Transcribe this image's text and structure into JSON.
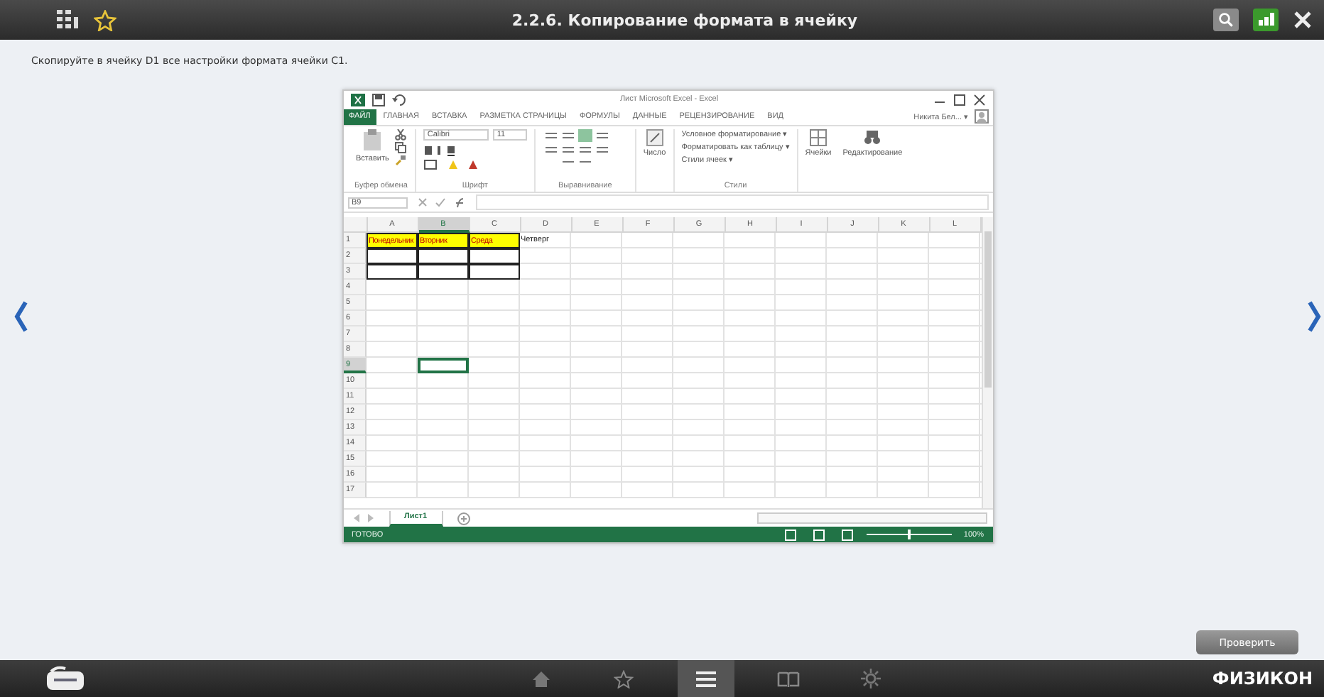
{
  "top_bar": {
    "title": "2.2.6. Копирование формата в ячейку"
  },
  "instruction": "Скопируйте в ячейку D1 все настройки формата ячейки C1.",
  "excel": {
    "title": "Лист Microsoft Excel - Excel",
    "tabs": [
      {
        "label": "ФАЙЛ",
        "selected": true
      },
      {
        "label": "ГЛАВНАЯ",
        "selected": false
      },
      {
        "label": "ВСТАВКА",
        "selected": false
      },
      {
        "label": "РАЗМЕТКА СТРАНИЦЫ",
        "selected": false
      },
      {
        "label": "ФОРМУЛЫ",
        "selected": false
      },
      {
        "label": "ДАННЫЕ",
        "selected": false
      },
      {
        "label": "РЕЦЕНЗИРОВАНИЕ",
        "selected": false
      },
      {
        "label": "ВИД",
        "selected": false
      }
    ],
    "user": "Никита Бел... ▾",
    "ribbon": {
      "paste": "Вставить",
      "font_name": "Calibri",
      "font_size": "11",
      "number": "Число",
      "styles": [
        "Условное форматирование ▾",
        "Форматировать как таблицу ▾",
        "Стили ячеек ▾"
      ],
      "cells": "Ячейки",
      "editing": "Редактирование",
      "groups": [
        "Буфер обмена",
        "Шрифт",
        "Выравнивание",
        "Стили"
      ]
    },
    "name_box": "B9",
    "columns": [
      {
        "label": "A",
        "selected": false
      },
      {
        "label": "B",
        "selected": true
      },
      {
        "label": "C",
        "selected": false
      },
      {
        "label": "D",
        "selected": false
      },
      {
        "label": "E",
        "selected": false
      },
      {
        "label": "F",
        "selected": false
      },
      {
        "label": "G",
        "selected": false
      },
      {
        "label": "H",
        "selected": false
      },
      {
        "label": "I",
        "selected": false
      },
      {
        "label": "J",
        "selected": false
      },
      {
        "label": "K",
        "selected": false
      },
      {
        "label": "L",
        "selected": false
      }
    ],
    "rows": [
      {
        "label": "1",
        "selected": false,
        "cells": [
          {
            "text": "Понедельник",
            "formatted": true,
            "bordered": true
          },
          {
            "text": "Вторник",
            "formatted": true,
            "bordered": true
          },
          {
            "text": "Среда",
            "formatted": true,
            "bordered": true
          },
          {
            "text": "Четверг",
            "formatted": false,
            "bordered": false
          }
        ]
      },
      {
        "label": "2",
        "selected": false,
        "cells": [
          {
            "bordered": true
          },
          {
            "bordered": true
          },
          {
            "bordered": true
          }
        ]
      },
      {
        "label": "3",
        "selected": false,
        "cells": [
          {
            "bordered": true
          },
          {
            "bordered": true
          },
          {
            "bordered": true
          }
        ]
      },
      {
        "label": "4",
        "selected": false
      },
      {
        "label": "5",
        "selected": false
      },
      {
        "label": "6",
        "selected": false
      },
      {
        "label": "7",
        "selected": false
      },
      {
        "label": "8",
        "selected": false
      },
      {
        "label": "9",
        "selected": true,
        "cells": [
          null,
          {
            "active": true
          }
        ]
      },
      {
        "label": "10",
        "selected": false
      },
      {
        "label": "11",
        "selected": false
      },
      {
        "label": "12",
        "selected": false
      },
      {
        "label": "13",
        "selected": false
      },
      {
        "label": "14",
        "selected": false
      },
      {
        "label": "15",
        "selected": false
      },
      {
        "label": "16",
        "selected": false
      },
      {
        "label": "17",
        "selected": false
      }
    ],
    "sheets": [
      {
        "label": "Лист1",
        "selected": true
      }
    ],
    "status": "ГОТОВО",
    "zoom": "100%",
    "zoom_slider": {
      "level": 0.5
    }
  },
  "check_button": "Проверить",
  "nav": [
    {
      "kind": "home",
      "selected": false
    },
    {
      "kind": "star",
      "selected": false
    },
    {
      "kind": "menu",
      "selected": true
    },
    {
      "kind": "book",
      "selected": false
    },
    {
      "kind": "gear",
      "selected": false
    }
  ],
  "brand": "ФИЗИКОН"
}
